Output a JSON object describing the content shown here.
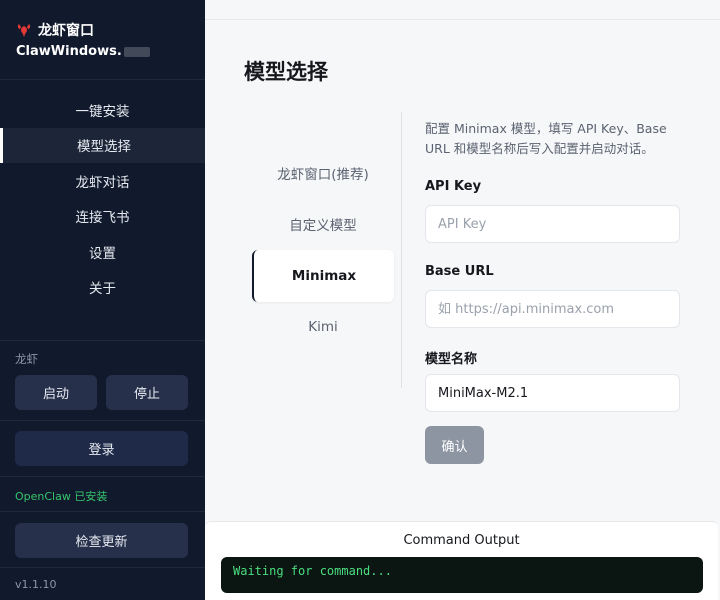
{
  "app": {
    "title": "龙虾窗口",
    "subtitle": "ClawWindows."
  },
  "sidebar": {
    "nav": [
      {
        "label": "一键安装"
      },
      {
        "label": "模型选择",
        "active": true
      },
      {
        "label": "龙虾对话"
      },
      {
        "label": "连接飞书"
      },
      {
        "label": "设置"
      },
      {
        "label": "关于"
      }
    ],
    "section_label": "龙虾",
    "start_label": "启动",
    "stop_label": "停止",
    "login_label": "登录",
    "install_status": "OpenClaw 已安装",
    "check_update_label": "检查更新",
    "version": "v1.1.10"
  },
  "main": {
    "title": "模型选择",
    "tabs": [
      {
        "label": "龙虾窗口(推荐)"
      },
      {
        "label": "自定义模型"
      },
      {
        "label": "Minimax",
        "active": true
      },
      {
        "label": "Kimi"
      }
    ],
    "description": "配置 Minimax 模型，填写 API Key、Base URL 和模型名称后写入配置并启动对话。",
    "fields": {
      "api_key": {
        "label": "API Key",
        "placeholder": "API Key",
        "value": ""
      },
      "base_url": {
        "label": "Base URL",
        "placeholder": "如 https://api.minimax.com",
        "value": ""
      },
      "model_name": {
        "label": "模型名称",
        "placeholder": "",
        "value": "MiniMax-M2.1"
      }
    },
    "confirm_label": "确认"
  },
  "command_output": {
    "title": "Command Output",
    "text": "Waiting for command..."
  },
  "colors": {
    "sidebar_bg": "#111a2c",
    "accent_green": "#37c46b",
    "terminal_text": "#4ade80",
    "brand_red": "#e53935"
  },
  "icons": {
    "brand": "lobster-icon"
  }
}
